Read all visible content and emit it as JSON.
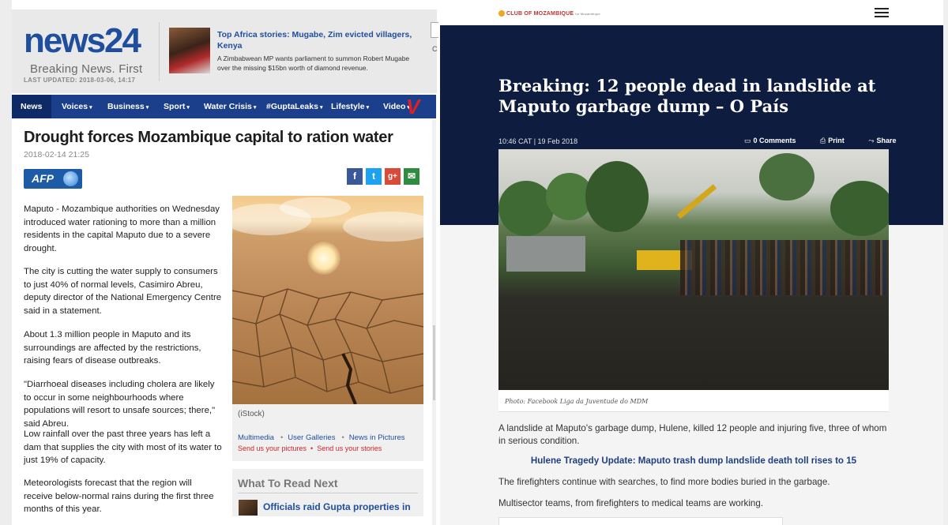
{
  "news24": {
    "logo_text": "news",
    "logo_num": "24",
    "tagline": "Breaking News. First",
    "last_updated": "LAST UPDATED: 2018-03-06, 14:17",
    "top_story": {
      "title": "Top Africa stories: Mugabe, Zim evicted villagers, Kenya",
      "desc": "A Zimbabwean MP wants parliament to summon Robert Mugabe over the missing $15bn worth of diamond revenue."
    },
    "side_letter": "C",
    "nav": [
      {
        "label": "News"
      },
      {
        "label": "Voices"
      },
      {
        "label": "Business"
      },
      {
        "label": "Sport"
      },
      {
        "label": "Water Crisis"
      },
      {
        "label": "#GuptaLeaks"
      },
      {
        "label": "Lifestyle"
      },
      {
        "label": "Video"
      }
    ],
    "nav_caret": "▾",
    "video_logo": "V",
    "article": {
      "headline": "Drought forces Mozambique capital to ration water",
      "date": "2018-02-14 21:25",
      "source_logo": "AFP",
      "share": {
        "fb": "f",
        "tw": "t",
        "gp": "g+",
        "em": "✉"
      },
      "paragraphs": [
        "Maputo - Mozambique authorities on Wednesday introduced water rationing to more than a million residents in the capital Maputo due to a severe drought.",
        "The city is cutting the water supply to consumers to just 40% of normal levels, Casimiro Abreu, deputy director of the National Emergency Centre said in a statement.",
        "About 1.3 million people in Maputo and its surroundings are affected by the restrictions, raising fears of disease outbreaks.",
        "\"Diarrhoeal diseases including cholera are likely to occur in some neighbourhoods where populations will resort to unsafe sources; there,\" said Abreu.",
        "Low rainfall over the past three years has left a dam that supplies the city with most of its water to just 19% of capacity.",
        "Meteorologists forecast that the region will receive below-normal rains during the first three months of this year."
      ],
      "image_credit": "(iStock)",
      "media_links": [
        "Multimedia",
        "User Galleries",
        "News in Pictures"
      ],
      "send_links": [
        "Send us your pictures",
        "Send us your stories"
      ],
      "what_to_read_title": "What To Read Next",
      "what_to_read_item": "Officials raid Gupta properties in"
    }
  },
  "club": {
    "logo_text": "CLUB OF MOZAMBIQUE",
    "logo_sub": "for Mozambique",
    "title": "Breaking: 12 people dead in landslide at Maputo garbage dump – O País",
    "meta": "10:46 CAT | 19 Feb 2018",
    "actions": {
      "comments": "0 Comments",
      "print": "Print",
      "share": "Share"
    },
    "photo_caption": "Photo: Facebook Liga da Juventude do MDM",
    "body": [
      "A landslide at Maputo's garbage dump, Hulene, killed 12 people and injuring five, three of whom in serious condition.",
      "The firefighters continue with  searches, to find more bodies buried in the garbage.",
      "Multisector teams, from firefighters to medical teams are working."
    ],
    "related_link": "Hulene Tragedy Update: Maputo trash dump landslide death toll rises to 15"
  }
}
